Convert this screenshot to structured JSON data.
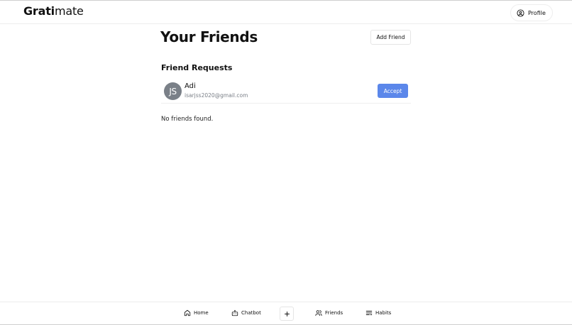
{
  "header": {
    "brand_bold": "Grati",
    "brand_regular": "mate",
    "profile_label": "Profile",
    "profile_icon": "user-circle-icon"
  },
  "main": {
    "title": "Your Friends",
    "add_friend_label": "Add Friend",
    "requests_title": "Friend Requests",
    "requests": [
      {
        "initials": "JS",
        "name": "Adi",
        "email": "isarjss2020@gmail.com",
        "accept_label": "Accept"
      }
    ],
    "empty_message": "No friends found."
  },
  "bottom_nav": {
    "items": [
      {
        "label": "Home",
        "icon": "home-icon"
      },
      {
        "label": "Chatbot",
        "icon": "bot-icon"
      },
      {
        "label": "Friends",
        "icon": "users-icon"
      },
      {
        "label": "Habits",
        "icon": "list-icon"
      }
    ],
    "add_icon": "plus-icon"
  },
  "colors": {
    "accent": "#5b87ea",
    "avatar_bg": "#7a8088",
    "muted_text": "#7a7f87"
  }
}
